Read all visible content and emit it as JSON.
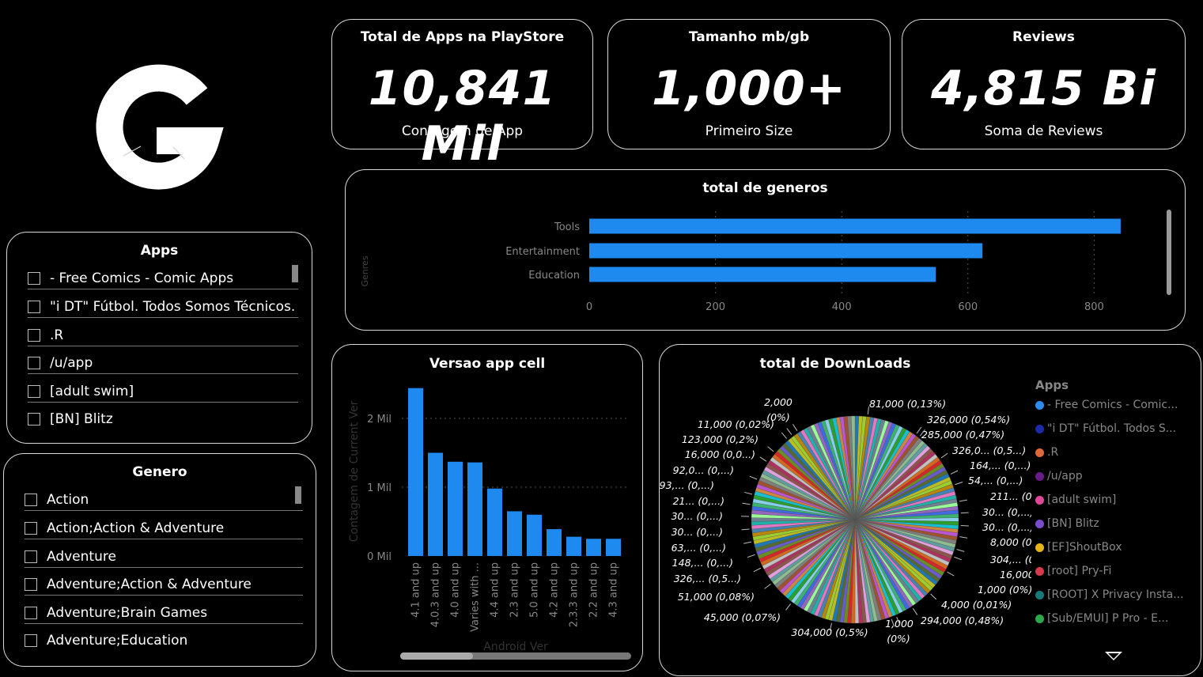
{
  "kpis": [
    {
      "title": "Total de Apps na PlayStore",
      "value": "10,841 Mil",
      "subtitle": "Contagem de App"
    },
    {
      "title": "Tamanho mb/gb",
      "value": "1,000+",
      "subtitle": "Primeiro Size"
    },
    {
      "title": "Reviews",
      "value": "4,815 Bi",
      "subtitle": "Soma de Reviews"
    }
  ],
  "logo": {
    "letter": "G"
  },
  "apps_slicer": {
    "title": "Apps",
    "items": [
      "- Free Comics - Comic Apps",
      "\"i DT\" Fútbol. Todos Somos Técnicos.",
      ".R",
      "/u/app",
      "[adult swim]",
      "[BN] Blitz"
    ]
  },
  "genero_slicer": {
    "title": "Genero",
    "items": [
      "Action",
      "Action;Action & Adventure",
      "Adventure",
      "Adventure;Action & Adventure",
      "Adventure;Brain Games",
      "Adventure;Education"
    ]
  },
  "colors": {
    "bar": "#1e8af0",
    "border": "#d8d8d8",
    "muted": "#888888"
  },
  "chart_data": [
    {
      "type": "bar",
      "orientation": "horizontal",
      "title": "total de generos",
      "ylabel": "Genres",
      "categories": [
        "Tools",
        "Entertainment",
        "Education"
      ],
      "values": [
        842,
        623,
        549
      ],
      "xticks": [
        "0",
        "200",
        "400",
        "600",
        "800"
      ],
      "xlim": [
        0,
        850
      ],
      "grid": true
    },
    {
      "type": "bar",
      "title": "Versao app cell",
      "xlabel": "Android Ver",
      "ylabel": "Contagem de Current Ver",
      "categories": [
        "4.1 and up",
        "4.0.3 and up",
        "4.0 and up",
        "Varies with ...",
        "4.4 and up",
        "2.3 and up",
        "5.0 and up",
        "4.2 and up",
        "2.3.3 and up",
        "2.2 and up",
        "4.3 and up"
      ],
      "values": [
        2.44,
        1.5,
        1.37,
        1.36,
        0.98,
        0.65,
        0.6,
        0.39,
        0.28,
        0.25,
        0.25
      ],
      "yticks": [
        "0 Mil",
        "1 Mil",
        "2 Mil"
      ],
      "ylim": [
        0,
        2.5
      ],
      "grid": true
    },
    {
      "type": "pie",
      "title": "total de DownLoads",
      "legend_title": "Apps",
      "legend_position": "right",
      "legend": [
        {
          "name": "- Free Comics - Comic...",
          "color": "#2b8cf0"
        },
        {
          "name": "\"i DT\" Fútbol. Todos S...",
          "color": "#1a2aa8"
        },
        {
          "name": ".R",
          "color": "#e0683a"
        },
        {
          "name": "/u/app",
          "color": "#6a1b8a"
        },
        {
          "name": "[adult swim]",
          "color": "#e0479a"
        },
        {
          "name": "[BN] Blitz",
          "color": "#7b4cd0"
        },
        {
          "name": "[EF]ShoutBox",
          "color": "#e6b417"
        },
        {
          "name": "[root] Pry-Fi",
          "color": "#d63a4a"
        },
        {
          "name": "[ROOT] X Privacy Insta...",
          "color": "#177a7a"
        },
        {
          "name": "[Sub/EMUI] P Pro - E...",
          "color": "#2aa84a"
        }
      ],
      "slice_labels": [
        {
          "text": "81,000 (0,13%)",
          "side": "right"
        },
        {
          "text": "326,000 (0,54%)",
          "side": "right"
        },
        {
          "text": "285,000 (0,47%)",
          "side": "right"
        },
        {
          "text": "326,0... (0,5...)",
          "side": "right"
        },
        {
          "text": "164,... (0,...)",
          "side": "right"
        },
        {
          "text": "54,... (0,...)",
          "side": "right"
        },
        {
          "text": "211... (0,...)",
          "side": "right"
        },
        {
          "text": "30... (0,...)",
          "side": "right"
        },
        {
          "text": "30... (0,...)",
          "side": "right"
        },
        {
          "text": "8,000 (0,...)",
          "side": "right"
        },
        {
          "text": "304,... (0,...)",
          "side": "right"
        },
        {
          "text": "16,000 (0,0...)",
          "side": "right"
        },
        {
          "text": "1,000 (0%)",
          "side": "right"
        },
        {
          "text": "4,000 (0,01%)",
          "side": "right"
        },
        {
          "text": "294,000 (0,48%)",
          "side": "right"
        },
        {
          "text": "1,000",
          "side": "bottom"
        },
        {
          "text": "(0%)",
          "side": "bottom"
        },
        {
          "text": "304,000 (0,5%)",
          "side": "bottom"
        },
        {
          "text": "45,000 (0,07%)",
          "side": "left"
        },
        {
          "text": "51,000 (0,08%)",
          "side": "left"
        },
        {
          "text": "326,... (0,5...)",
          "side": "left"
        },
        {
          "text": "148,... (0,...)",
          "side": "left"
        },
        {
          "text": "63,... (0,...)",
          "side": "left"
        },
        {
          "text": "30... (0,...)",
          "side": "left"
        },
        {
          "text": "30... (0,...)",
          "side": "left"
        },
        {
          "text": "21... (0,...)",
          "side": "left"
        },
        {
          "text": "93,... (0,...)",
          "side": "left"
        },
        {
          "text": "92,0... (0,...)",
          "side": "left"
        },
        {
          "text": "16,000 (0,0...)",
          "side": "left"
        },
        {
          "text": "123,000 (0,2%)",
          "side": "left"
        },
        {
          "text": "11,000 (0,02%)",
          "side": "left"
        },
        {
          "text": "2,000",
          "side": "top"
        },
        {
          "text": "(0%)",
          "side": "top"
        }
      ]
    }
  ]
}
